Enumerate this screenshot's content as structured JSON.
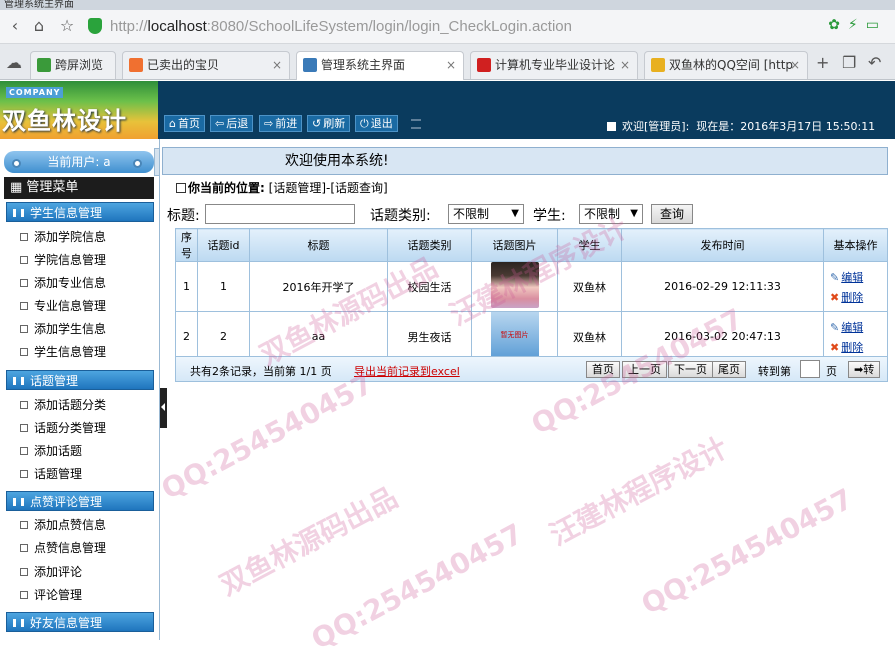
{
  "browser": {
    "title_fragment": "管理系统主界面",
    "url_scheme": "http://",
    "url_host": "localhost",
    "url_rest": ":8080/SchoolLifeSystem/login/login_CheckLogin.action",
    "tabs": [
      {
        "label": "跨屏浏览",
        "icon_color": "#3a9a3a"
      },
      {
        "label": "已卖出的宝贝",
        "icon_color": "#f07030"
      },
      {
        "label": "管理系统主界面",
        "icon_color": "#3a7ab8"
      },
      {
        "label": "计算机专业毕业设计论",
        "icon_color": "#d02020"
      },
      {
        "label": "双鱼林的QQ空间 [http",
        "icon_color": "#e8b020"
      }
    ]
  },
  "header": {
    "company": "COMPANY",
    "brand": "双鱼林设计",
    "buttons": [
      {
        "label": "首页",
        "icon": "home-icon",
        "glyph": "⌂"
      },
      {
        "label": "后退",
        "icon": "back-icon",
        "glyph": "⇦"
      },
      {
        "label": "前进",
        "icon": "forward-icon",
        "glyph": "⇨"
      },
      {
        "label": "刷新",
        "icon": "refresh-icon",
        "glyph": "↺"
      },
      {
        "label": "退出",
        "icon": "power-icon",
        "glyph": "⏻"
      }
    ],
    "welcome_text": "欢迎[管理员]:",
    "time_text": "现在是：2016年3月17日 15:50:11"
  },
  "sidebar": {
    "current_user": "当前用户: a",
    "menu_title": "管理菜单",
    "groups": [
      {
        "title": "学生信息管理",
        "items": [
          "添加学院信息",
          "学院信息管理",
          "添加专业信息",
          "专业信息管理",
          "添加学生信息",
          "学生信息管理"
        ]
      },
      {
        "title": "话题管理",
        "items": [
          "添加话题分类",
          "话题分类管理",
          "添加话题",
          "话题管理"
        ]
      },
      {
        "title": "点赞评论管理",
        "items": [
          "添加点赞信息",
          "点赞信息管理",
          "添加评论",
          "评论管理"
        ]
      },
      {
        "title": "好友信息管理",
        "items": []
      }
    ]
  },
  "main": {
    "welcome": "欢迎使用本系统!",
    "location_label": "你当前的位置:",
    "location_path": "[话题管理]-[话题查询]",
    "search": {
      "title_label": "标题:",
      "title_value": "",
      "category_label": "话题类别:",
      "category_value": "不限制",
      "student_label": "学生:",
      "student_value": "不限制",
      "query_button": "查询"
    },
    "table": {
      "headers": [
        "序号",
        "话题id",
        "标题",
        "话题类别",
        "话题图片",
        "学生",
        "发布时间",
        "基本操作"
      ],
      "rows": [
        {
          "no": "1",
          "id": "1",
          "title": "2016年开学了",
          "category": "校园生活",
          "image": "photo",
          "image_text": "",
          "student": "双鱼林",
          "time": "2016-02-29 12:11:33",
          "edit": "编辑",
          "delete": "删除"
        },
        {
          "no": "2",
          "id": "2",
          "title": "aa",
          "category": "男生夜话",
          "image": "placeholder",
          "image_text": "暂无图片",
          "student": "双鱼林",
          "time": "2016-03-02 20:47:13",
          "edit": "编辑",
          "delete": "删除"
        }
      ]
    },
    "pager": {
      "info": "共有2条记录，当前第 1/1 页",
      "export": "导出当前记录到excel",
      "first": "首页",
      "prev": "上一页",
      "next": "下一页",
      "last": "尾页",
      "goto_label": "转到第",
      "goto_value": "",
      "page_suffix": "页",
      "go_button": "➡转"
    }
  },
  "watermarks": [
    "QQ:254540457",
    "双鱼林源码出品",
    "汪建林程序设计"
  ]
}
